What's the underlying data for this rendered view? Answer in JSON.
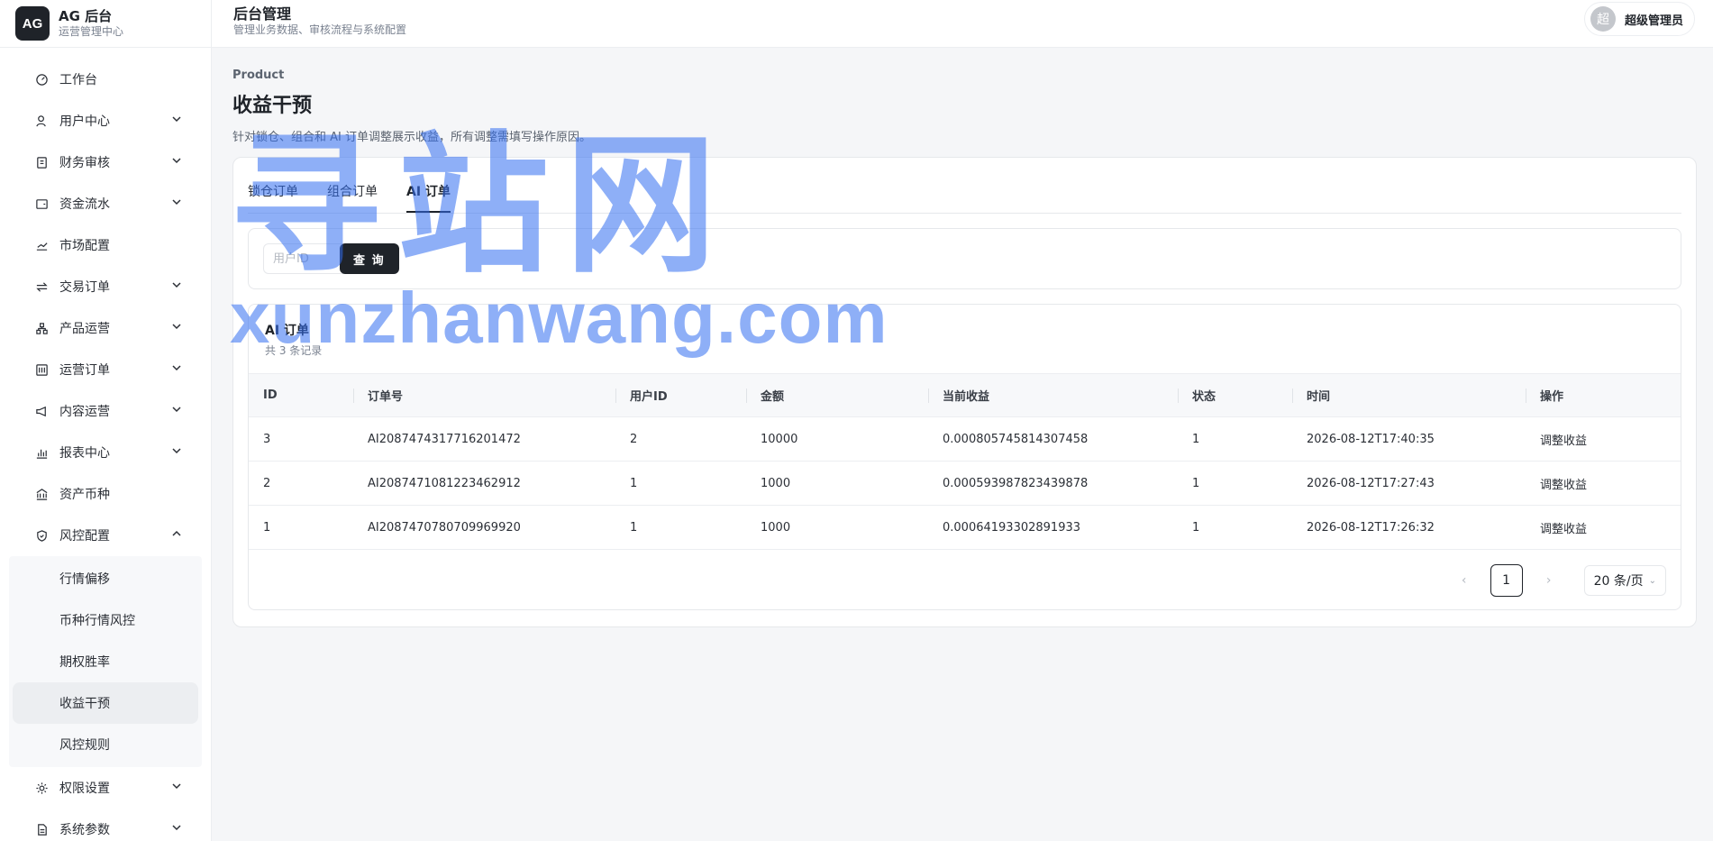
{
  "brand": {
    "logo": "AG",
    "title": "AG 后台",
    "subtitle": "运营管理中心"
  },
  "nav": [
    {
      "label": "工作台",
      "icon": "dashboard-icon"
    },
    {
      "label": "用户中心",
      "icon": "user-icon"
    },
    {
      "label": "财务审核",
      "icon": "audit-icon"
    },
    {
      "label": "资金流水",
      "icon": "wallet-icon"
    },
    {
      "label": "市场配置",
      "icon": "chart-line-icon"
    },
    {
      "label": "交易订单",
      "icon": "swap-icon"
    },
    {
      "label": "产品运营",
      "icon": "org-icon"
    },
    {
      "label": "运营订单",
      "icon": "calculator-icon"
    },
    {
      "label": "内容运营",
      "icon": "megaphone-icon"
    },
    {
      "label": "报表中心",
      "icon": "bar-chart-icon"
    },
    {
      "label": "资产币种",
      "icon": "bank-icon"
    },
    {
      "label": "风控配置",
      "icon": "shield-icon"
    },
    {
      "label": "权限设置",
      "icon": "gear-icon"
    },
    {
      "label": "系统参数",
      "icon": "document-icon"
    }
  ],
  "risk_submenu": [
    {
      "label": "行情偏移"
    },
    {
      "label": "币种行情风控"
    },
    {
      "label": "期权胜率"
    },
    {
      "label": "收益干预"
    },
    {
      "label": "风控规则"
    }
  ],
  "header": {
    "title": "后台管理",
    "subtitle": "管理业务数据、审核流程与系统配置"
  },
  "user": {
    "avatar": "超",
    "name": "超级管理员"
  },
  "page": {
    "crumb": "Product",
    "title": "收益干预",
    "desc": "针对锁仓、组合和 AI 订单调整展示收益，所有调整需填写操作原因。"
  },
  "tabs": [
    {
      "label": "锁仓订单"
    },
    {
      "label": "组合订单"
    },
    {
      "label": "AI 订单"
    }
  ],
  "filter": {
    "placeholder": "用户ID",
    "query_label": "查 询"
  },
  "table": {
    "title": "AI 订单",
    "count": "共 3 条记录",
    "columns": [
      "ID",
      "订单号",
      "用户ID",
      "金额",
      "当前收益",
      "状态",
      "时间",
      "操作"
    ],
    "rows": [
      {
        "id": "3",
        "order_no": "AI2087474317716201472",
        "user_id": "2",
        "amount": "10000",
        "profit": "0.000805745814307458",
        "status": "1",
        "time": "2026-08-12T17:40:35",
        "action": "调整收益"
      },
      {
        "id": "2",
        "order_no": "AI2087471081223462912",
        "user_id": "1",
        "amount": "1000",
        "profit": "0.000593987823439878",
        "status": "1",
        "time": "2026-08-12T17:27:43",
        "action": "调整收益"
      },
      {
        "id": "1",
        "order_no": "AI2087470780709969920",
        "user_id": "1",
        "amount": "1000",
        "profit": "0.00064193302891933",
        "status": "1",
        "time": "2026-08-12T17:26:32",
        "action": "调整收益"
      }
    ]
  },
  "pagination": {
    "current": "1",
    "page_size": "20 条/页"
  },
  "watermark": {
    "cn": "寻站网",
    "en": "xunzhanwang.com"
  },
  "colors": {
    "accent": "#1f2329",
    "watermark": "#326ef0"
  }
}
